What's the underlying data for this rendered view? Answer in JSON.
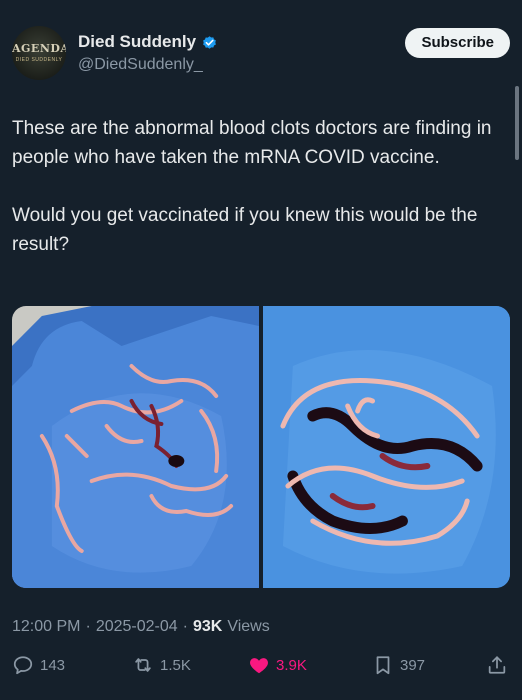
{
  "author": {
    "display_name": "Died Suddenly",
    "handle": "@DiedSuddenly_",
    "avatar_text": "AGENDA",
    "avatar_subtext": "DIED SUDDENLY",
    "verified": true
  },
  "subscribe_label": "Subscribe",
  "tweet": {
    "paragraph_1": "These are the abnormal blood clots doctors are finding in people who have taken the mRNA COVID vaccine.",
    "paragraph_2": "Would you get vaccinated if you knew this would be the result?"
  },
  "media": {
    "left_image": "photo of stringy blood clots laid on a blue-gloved palm",
    "right_image": "photo of a long dark clot mass on a blue-gloved hand"
  },
  "meta": {
    "time": "12:00 PM",
    "date": "2025-02-04",
    "views_count": "93K",
    "views_label": "Views"
  },
  "actions": {
    "replies": "143",
    "reposts": "1.5K",
    "likes": "3.9K",
    "bookmarks": "397"
  },
  "colors": {
    "background": "#15202b",
    "text": "#e7e9ea",
    "secondary": "#8b98a5",
    "like": "#f91880",
    "verified": "#1d9bf0"
  }
}
